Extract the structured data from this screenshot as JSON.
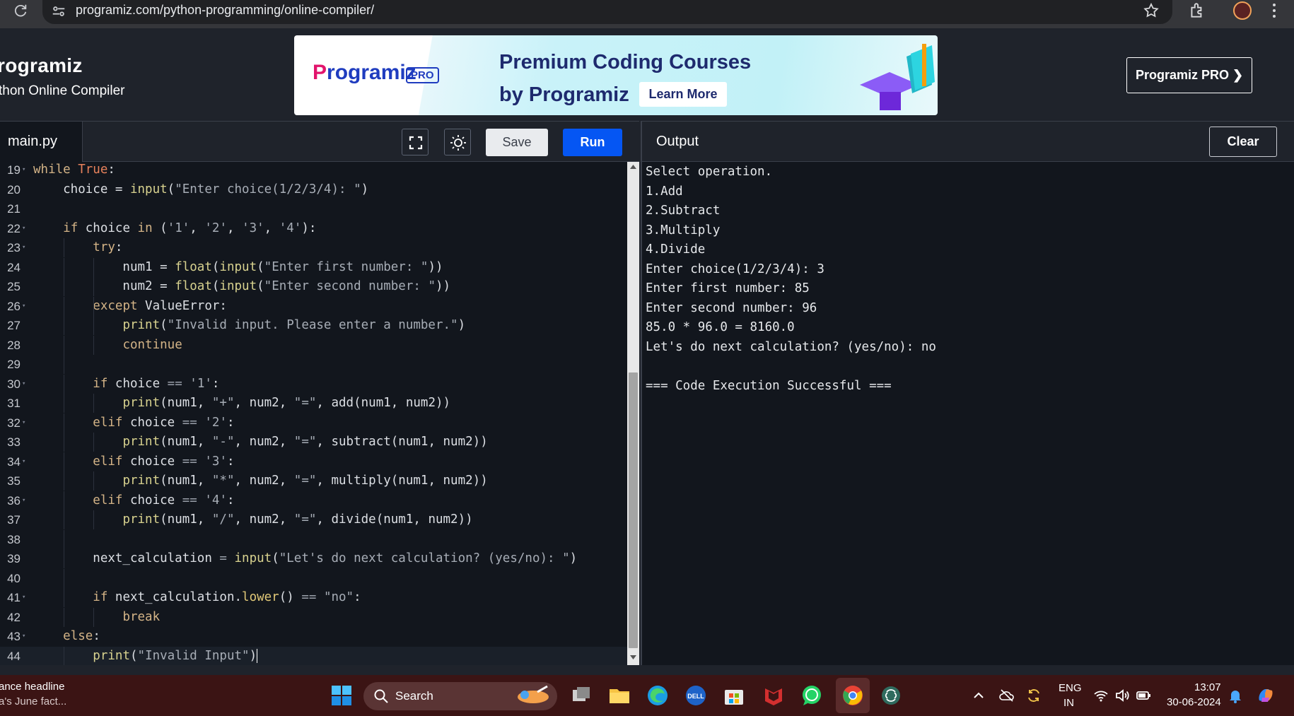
{
  "browser": {
    "url": "programiz.com/python-programming/online-compiler/"
  },
  "header": {
    "logo": "rogramiz",
    "subtitle": "thon Online Compiler",
    "banner_logo_p": "P",
    "banner_logo_rest": "rogramiz",
    "banner_pro": "PRO",
    "banner_title_line1": "Premium Coding Courses",
    "banner_title_line2": "by Programiz",
    "banner_cta": "Learn More",
    "pro_button": "Programiz PRO ❯"
  },
  "editor": {
    "file_tab": "main.py",
    "save_label": "Save",
    "run_label": "Run",
    "lines": [
      {
        "n": "19",
        "fold": true,
        "html": "<span class=\"kw\">while</span> <span class=\"tr\">True</span>:"
      },
      {
        "n": "20",
        "fold": false,
        "html": "    choice = <span class=\"bi\">input</span>(<span class=\"st\">\"Enter choice(1/2/3/4): \"</span>)"
      },
      {
        "n": "21",
        "fold": false,
        "html": ""
      },
      {
        "n": "22",
        "fold": true,
        "html": "    <span class=\"kw\">if</span> choice <span class=\"kw\">in</span> (<span class=\"st\">'1'</span>, <span class=\"st\">'2'</span>, <span class=\"st\">'3'</span>, <span class=\"st\">'4'</span>):"
      },
      {
        "n": "23",
        "fold": true,
        "html": "        <span class=\"kw\">try</span>:"
      },
      {
        "n": "24",
        "fold": false,
        "html": "            num1 = <span class=\"bi\">float</span>(<span class=\"bi\">input</span>(<span class=\"st\">\"Enter first number: \"</span>))"
      },
      {
        "n": "25",
        "fold": false,
        "html": "            num2 = <span class=\"bi\">float</span>(<span class=\"bi\">input</span>(<span class=\"st\">\"Enter second number: \"</span>))"
      },
      {
        "n": "26",
        "fold": true,
        "html": "        <span class=\"kw\">except</span> ValueError:"
      },
      {
        "n": "27",
        "fold": false,
        "html": "            <span class=\"bi\">print</span>(<span class=\"st\">\"Invalid input. Please enter a number.\"</span>)"
      },
      {
        "n": "28",
        "fold": false,
        "html": "            <span class=\"kw\">continue</span>"
      },
      {
        "n": "29",
        "fold": false,
        "html": ""
      },
      {
        "n": "30",
        "fold": true,
        "html": "        <span class=\"kw\">if</span> choice <span class=\"op\">==</span> <span class=\"st\">'1'</span>:"
      },
      {
        "n": "31",
        "fold": false,
        "html": "            <span class=\"bi\">print</span>(num1, <span class=\"st\">\"+\"</span>, num2, <span class=\"st\">\"=\"</span>, add(num1, num2))"
      },
      {
        "n": "32",
        "fold": true,
        "html": "        <span class=\"kw\">elif</span> choice <span class=\"op\">==</span> <span class=\"st\">'2'</span>:"
      },
      {
        "n": "33",
        "fold": false,
        "html": "            <span class=\"bi\">print</span>(num1, <span class=\"st\">\"-\"</span>, num2, <span class=\"st\">\"=\"</span>, subtract(num1, num2))"
      },
      {
        "n": "34",
        "fold": true,
        "html": "        <span class=\"kw\">elif</span> choice <span class=\"op\">==</span> <span class=\"st\">'3'</span>:"
      },
      {
        "n": "35",
        "fold": false,
        "html": "            <span class=\"bi\">print</span>(num1, <span class=\"st\">\"*\"</span>, num2, <span class=\"st\">\"=\"</span>, multiply(num1, num2))"
      },
      {
        "n": "36",
        "fold": true,
        "html": "        <span class=\"kw\">elif</span> choice <span class=\"op\">==</span> <span class=\"st\">'4'</span>:"
      },
      {
        "n": "37",
        "fold": false,
        "html": "            <span class=\"bi\">print</span>(num1, <span class=\"st\">\"/\"</span>, num2, <span class=\"st\">\"=\"</span>, divide(num1, num2))"
      },
      {
        "n": "38",
        "fold": false,
        "html": ""
      },
      {
        "n": "39",
        "fold": false,
        "html": "        next_calculation <span class=\"op\">=</span> <span class=\"bi\">input</span>(<span class=\"st\">\"Let's do next calculation? (yes/no): \"</span>)"
      },
      {
        "n": "40",
        "fold": false,
        "html": ""
      },
      {
        "n": "41",
        "fold": true,
        "html": "        <span class=\"kw\">if</span> next_calculation.<span class=\"fn\">lower</span>() <span class=\"op\">==</span> <span class=\"st\">\"no\"</span>:"
      },
      {
        "n": "42",
        "fold": false,
        "html": "            <span class=\"kw\">break</span>"
      },
      {
        "n": "43",
        "fold": true,
        "html": "    <span class=\"kw\">else</span>:"
      },
      {
        "n": "44",
        "fold": false,
        "html": "        <span class=\"bi\">print</span>(<span class=\"st\">\"Invalid Input\"</span>)<span class=\"cursor\"></span>",
        "active": true
      }
    ]
  },
  "output": {
    "title": "Output",
    "clear_label": "Clear",
    "lines": [
      "Select operation.",
      "1.Add",
      "2.Subtract",
      "3.Multiply",
      "4.Divide",
      "Enter choice(1/2/3/4): 3",
      "Enter first number: 85",
      "Enter second number: 96",
      "85.0 * 96.0 = 8160.0",
      "Let's do next calculation? (yes/no): no",
      "",
      "=== Code Execution Successful ==="
    ]
  },
  "taskbar": {
    "news_title": "ance headline",
    "news_sub": "a's June fact...",
    "search_label": "Search",
    "lang_line1": "ENG",
    "lang_line2": "IN",
    "time": "13:07",
    "date": "30-06-2024"
  }
}
